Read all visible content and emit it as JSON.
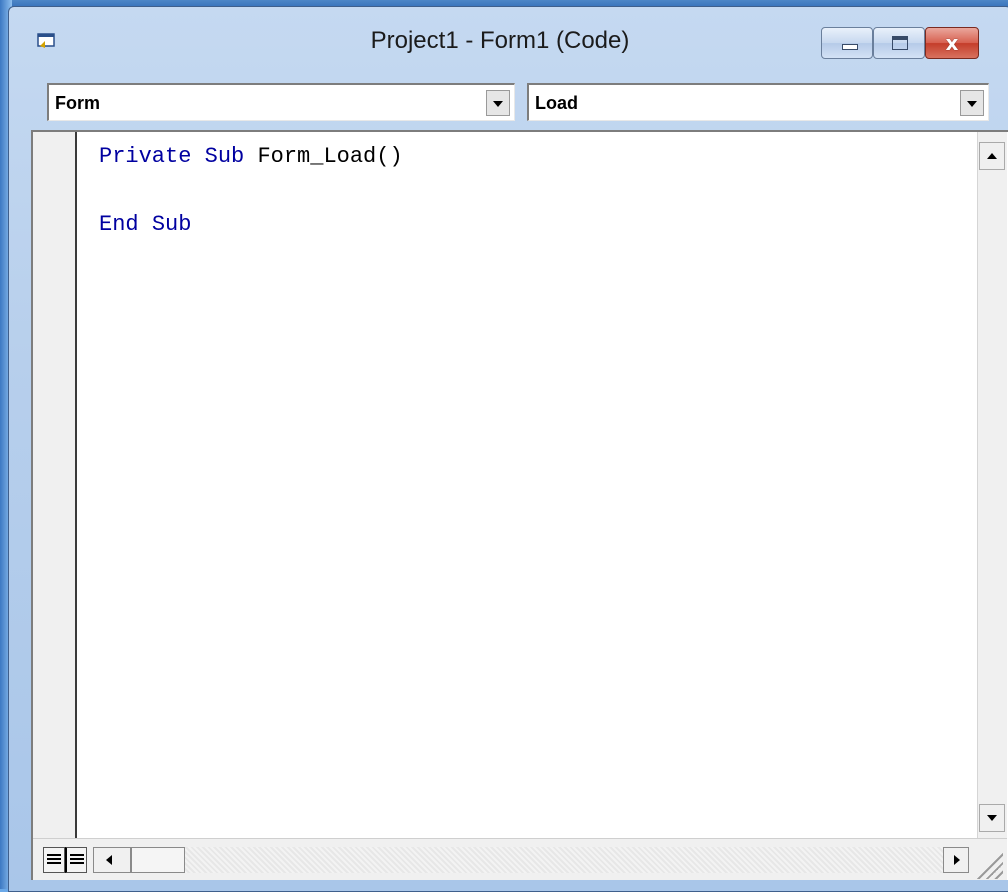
{
  "window": {
    "title": "Project1 - Form1 (Code)",
    "icons": {
      "app": "vb-code-window-icon",
      "minimize": "minimize-icon",
      "maximize": "maximize-icon",
      "close": "close-icon"
    },
    "close_glyph": "x",
    "colors": {
      "title_bar": "#b7cfec",
      "close_button": "#c43d2a",
      "keyword": "#0000a0"
    }
  },
  "object_combo": {
    "value": "Form",
    "icon": "chevron-down-icon"
  },
  "procedure_combo": {
    "value": "Load",
    "icon": "chevron-down-icon"
  },
  "code": {
    "lines": [
      {
        "kw1": "Private",
        "kw2": "Sub",
        "rest": "Form_Load()"
      },
      {
        "kw1": "End",
        "kw2": "Sub"
      }
    ]
  },
  "bottom": {
    "procedure_view_icon": "procedure-view-icon",
    "full_module_view_icon": "full-module-view-icon"
  }
}
